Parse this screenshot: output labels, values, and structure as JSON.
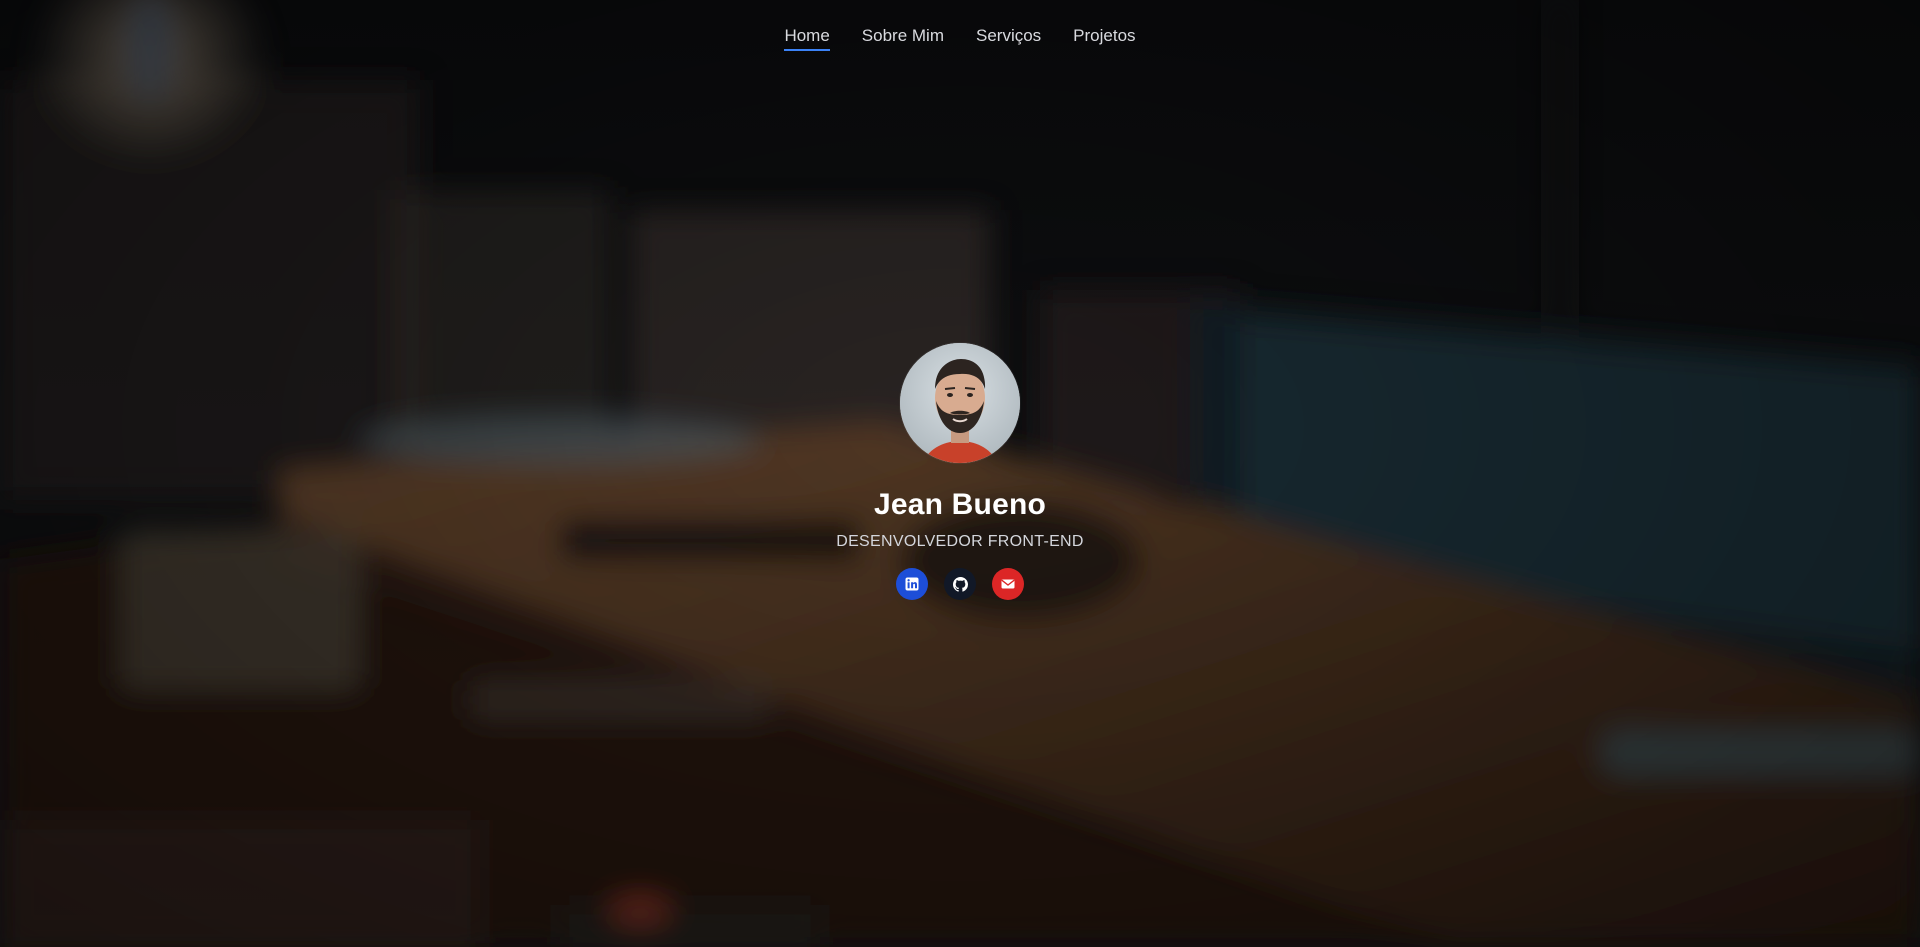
{
  "nav": {
    "items": [
      {
        "label": "Home",
        "active": true
      },
      {
        "label": "Sobre Mim",
        "active": false
      },
      {
        "label": "Serviços",
        "active": false
      },
      {
        "label": "Projetos",
        "active": false
      }
    ],
    "active_color": "#3b82f6"
  },
  "profile": {
    "name": "Jean Bueno",
    "role": "DESENVOLVEDOR FRONT-END",
    "avatar_icon": "user-photo"
  },
  "socials": [
    {
      "icon": "linkedin-icon",
      "color": "#1d4ed8"
    },
    {
      "icon": "github-icon",
      "color": "#111827"
    },
    {
      "icon": "envelope-icon",
      "color": "#dc2626"
    }
  ]
}
